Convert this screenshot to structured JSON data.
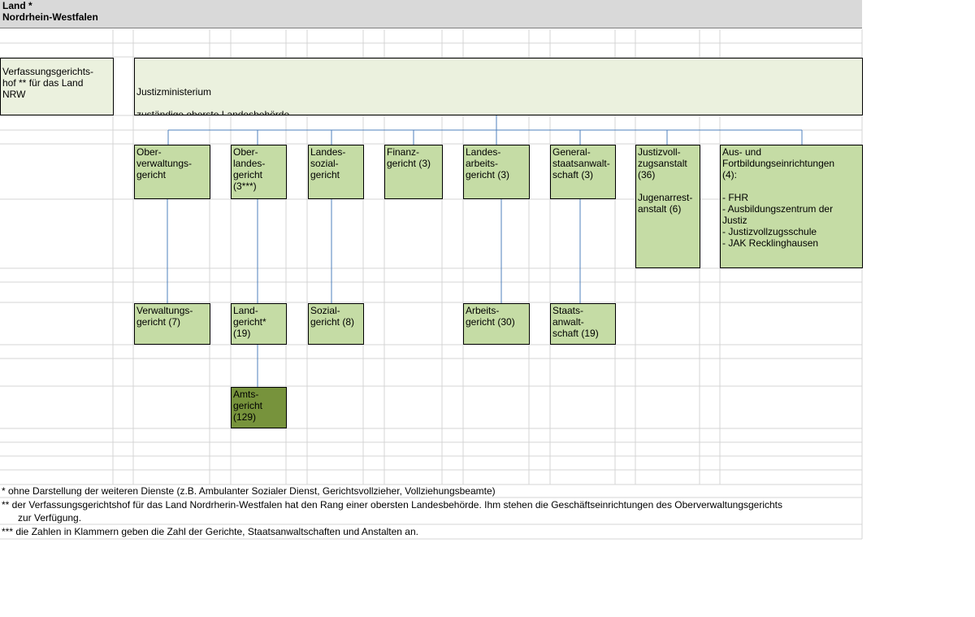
{
  "header": {
    "line1": "Land *",
    "line2": "Nordrhein-Westfalen"
  },
  "boxes": {
    "vgh": "Verfassungsgerichts-\nhof ** für das Land\nNRW",
    "jm_line1": "Justizministerium",
    "jm_line2": "zuständige oberste Landesbehörde",
    "ovg": "Ober-\nverwaltungs-\ngericht",
    "olg": "Ober-\nlandes-\ngericht\n(3***)",
    "lsg": "Landes-\nsozial-\ngericht",
    "fg": "Finanz-\ngericht (3)",
    "lag": "Landes-\narbeits-\ngericht (3)",
    "gsta": "General-\nstaatsanwalt-\nschaft (3)",
    "jva": "Justizvoll-\nzugsanstalt\n(36)\n\nJugenarrest-\nanstalt (6)",
    "ausb": "Aus- und\nFortbildungseinrichtungen\n(4):\n\n- FHR\n- Ausbildungszentrum der\nJustiz\n- Justizvollzugsschule\n- JAK Recklinghausen",
    "vg": "Verwaltungs-\ngericht (7)",
    "lg": "Land-\ngericht*\n(19)",
    "sg": "Sozial-\ngericht (8)",
    "ag_arb": "Arbeits-\ngericht (30)",
    "sta": "Staats-\nanwalt-\nschaft (19)",
    "amtsg": "Amts-\ngericht\n(129)"
  },
  "footnotes": {
    "f1": "*   ohne Darstellung der weiteren Dienste (z.B. Ambulanter Sozialer Dienst, Gerichtsvollzieher, Vollziehungsbeamte)",
    "f2a": "**  der Verfassungsgerichtshof für das Land Nordrherin-Westfalen hat den Rang einer obersten Landesbehörde. Ihm stehen die Geschäftseinrichtungen des Oberverwaltungsgerichts",
    "f2b": "zur Verfügung.",
    "f3": "*** die Zahlen in Klammern geben die Zahl der Gerichte, Staatsanwaltschaften und Anstalten an."
  },
  "colors": {
    "box_light": "#ebf1de",
    "box_mid": "#c5dca5",
    "box_dark": "#77933c",
    "connector": "#4f81bd",
    "gridline": "#d4d4d4",
    "header_bg": "#d9d9d9"
  }
}
